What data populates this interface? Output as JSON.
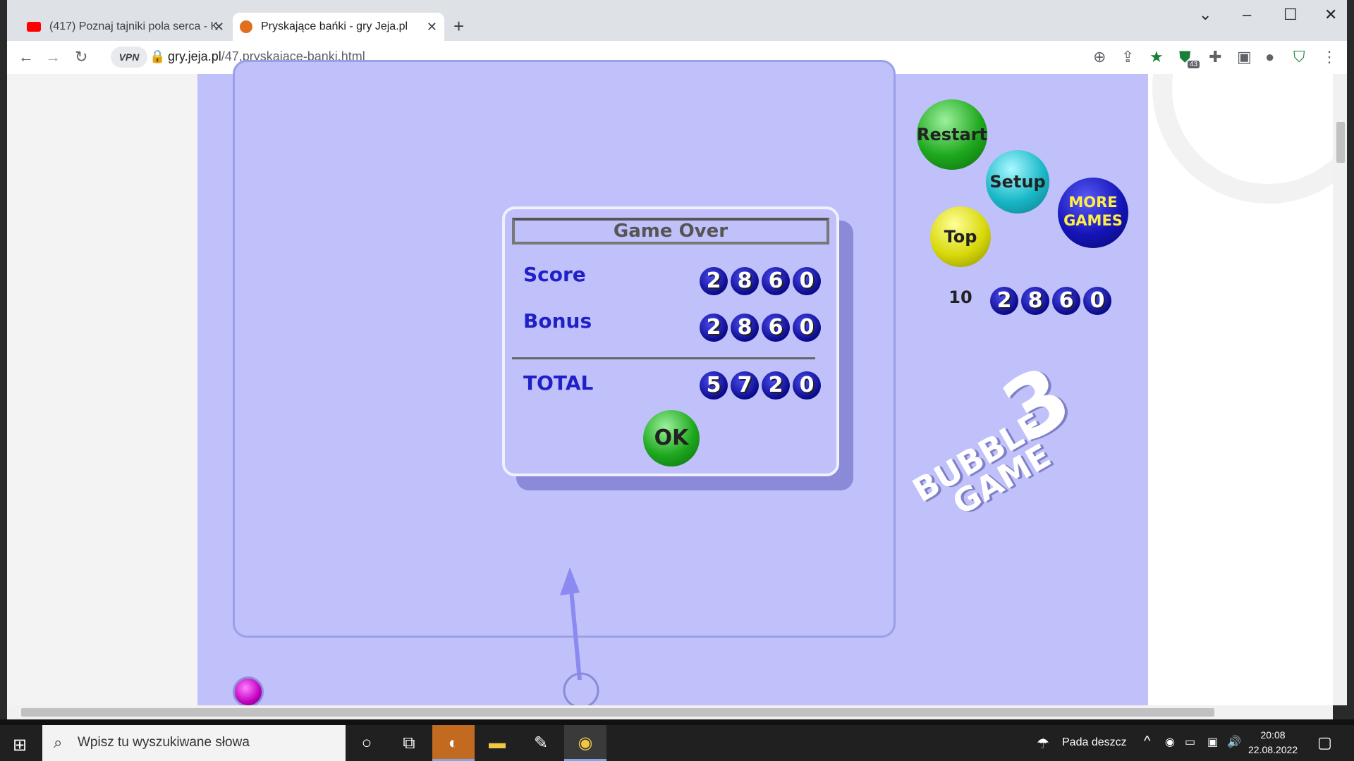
{
  "browser": {
    "tabs": [
      {
        "title": "(417) Poznaj tajniki pola serca - K",
        "active": false
      },
      {
        "title": "Pryskające bańki - gry Jeja.pl",
        "active": true
      }
    ],
    "url_host": "gry.jeja.pl",
    "url_path": "/47,pryskajace-banki.html",
    "vpn_label": "VPN",
    "extension_badge": "43"
  },
  "game": {
    "dialog": {
      "title": "Game Over",
      "score_label": "Score",
      "score_digits": [
        "2",
        "8",
        "6",
        "0"
      ],
      "bonus_label": "Bonus",
      "bonus_digits": [
        "2",
        "8",
        "6",
        "0"
      ],
      "total_label": "TOTAL",
      "total_digits": [
        "5",
        "7",
        "2",
        "0"
      ],
      "ok_label": "OK"
    },
    "buttons": {
      "restart": "Restart",
      "setup": "Setup",
      "top10": "Top 10",
      "more_line1": "MORE",
      "more_line2": "GAMES"
    },
    "side_score_digits": [
      "2",
      "8",
      "6",
      "0"
    ],
    "logo": {
      "line1": "BUBBLE",
      "line2": "GAME",
      "number": "3"
    },
    "colors": {
      "field": "#c0c0fa",
      "digit": "#1414b8",
      "next_ball": "#c000c0"
    }
  },
  "taskbar": {
    "search_placeholder": "Wpisz tu wyszukiwane słowa",
    "weather": "Pada deszcz",
    "time": "20:08",
    "date": "22.08.2022"
  }
}
